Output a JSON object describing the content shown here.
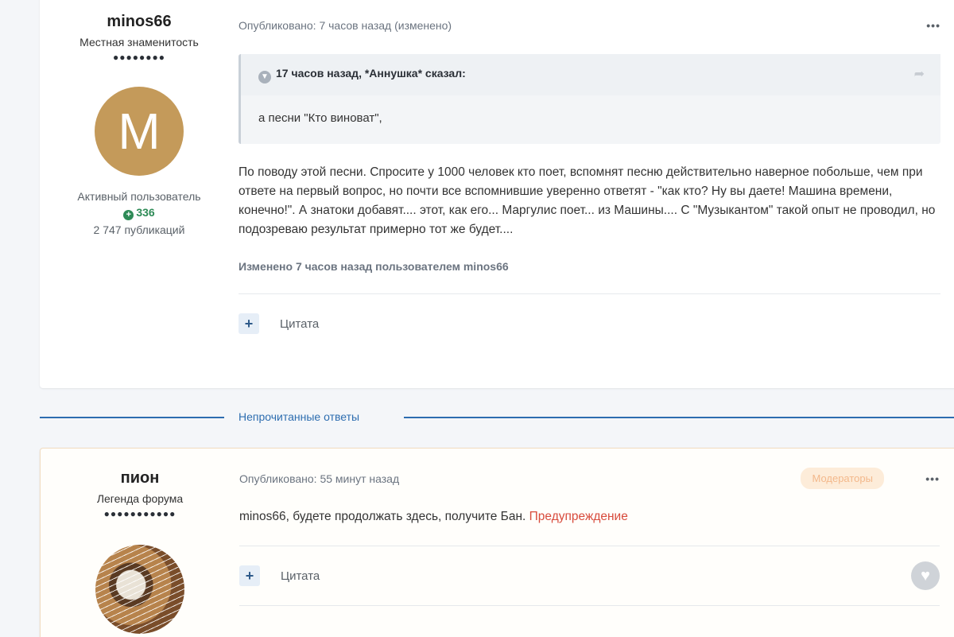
{
  "post1": {
    "author": {
      "name": "minos66",
      "title": "Местная знаменитость",
      "pips": "●●●●●●●●",
      "avatar_letter": "M",
      "group": "Активный пользователь",
      "reputation": "336",
      "posts": "2 747 публикаций"
    },
    "meta": "Опубликовано: 7 часов назад (изменено)",
    "more": "•••",
    "quote": {
      "header": "17 часов назад, *Аннушка* сказал:",
      "body": "а песни \"Кто виноват\","
    },
    "body": "По поводу этой песни. Спросите у 1000 человек кто поет, вспомнят песню действительно наверное побольше, чем при ответе на первый вопрос, но почти все вспомнившие уверенно ответят - \"как кто? Ну вы даете!  Машина времени, конечно!\". А знатоки добавят.... этот, как его... Маргулис поет... из Машины.... С \"Музыкантом\" такой опыт не проводил, но подозреваю результат примерно тот же будет....",
    "edit_note": "Изменено 7 часов назад пользователем minos66",
    "quote_button": "Цитата"
  },
  "unread_label": "Непрочитанные ответы",
  "post2": {
    "author": {
      "name": "пион",
      "title": "Легенда форума",
      "pips": "●●●●●●●●●●●"
    },
    "meta": "Опубликовано: 55 минут назад",
    "badge": "Модераторы",
    "more": "•••",
    "body_text": "minos66, будете продолжать здесь, получите Бан. ",
    "body_warning": "Предупреждение",
    "quote_button": "Цитата"
  },
  "colors": {
    "accent": "#2d6db0",
    "reputation": "#2e8b57",
    "warning": "#d84b3c",
    "avatar_bg": "#c49a5a"
  }
}
